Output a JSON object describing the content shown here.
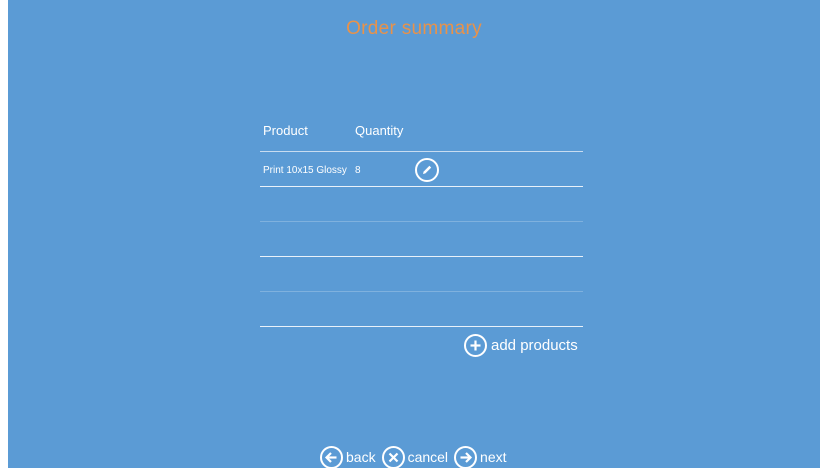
{
  "header": {
    "title": "Order summary"
  },
  "colors": {
    "background": "#5b9bd5",
    "title": "#e8924a",
    "text": "#ffffff"
  },
  "table": {
    "columns": {
      "product": "Product",
      "quantity": "Quantity"
    },
    "rows": [
      {
        "product": "Print 10x15 Glossy",
        "quantity": "8"
      }
    ]
  },
  "actions": {
    "add_products": "add products",
    "back": "back",
    "cancel": "cancel",
    "next": "next"
  },
  "icons": {
    "edit": "pencil-icon",
    "add": "plus-circle-icon",
    "back": "arrow-left-circle-icon",
    "cancel": "x-circle-icon",
    "next": "arrow-right-circle-icon"
  }
}
